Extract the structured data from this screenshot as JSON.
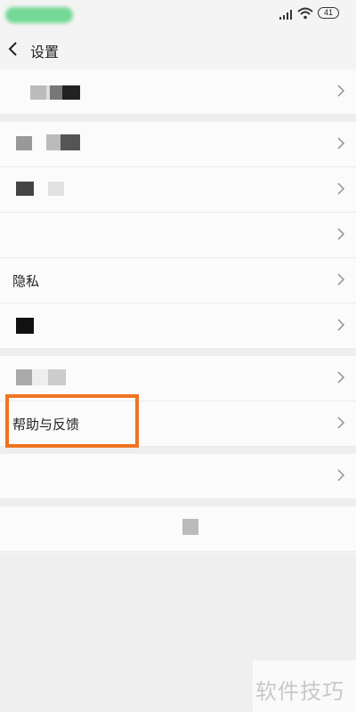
{
  "status_bar": {
    "battery": "41"
  },
  "header": {
    "title": "设置"
  },
  "list": {
    "privacy_label": "隐私",
    "help_feedback_label": "帮助与反馈"
  },
  "watermark": "软件技巧"
}
